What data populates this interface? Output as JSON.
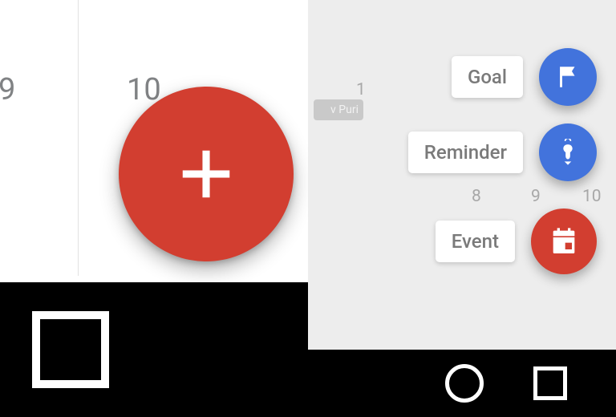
{
  "colors": {
    "fab_red": "#d23e30",
    "fab_blue": "#4273dc",
    "panel_right_bg": "#ededed"
  },
  "left_panel": {
    "dates": [
      "9",
      "10"
    ],
    "fab_icon": "plus-icon",
    "nav": {
      "recent_icon": "recent-apps-icon"
    }
  },
  "right_panel": {
    "background_hours": [
      "1",
      "8",
      "9",
      "10"
    ],
    "background_chip": "v Puri",
    "actions": [
      {
        "label": "Goal",
        "icon": "flag-icon",
        "color": "blue"
      },
      {
        "label": "Reminder",
        "icon": "reminder-icon",
        "color": "blue"
      },
      {
        "label": "Event",
        "icon": "calendar-icon",
        "color": "red"
      }
    ],
    "nav": {
      "home_icon": "home-circle-icon",
      "recent_icon": "recent-apps-icon"
    }
  }
}
